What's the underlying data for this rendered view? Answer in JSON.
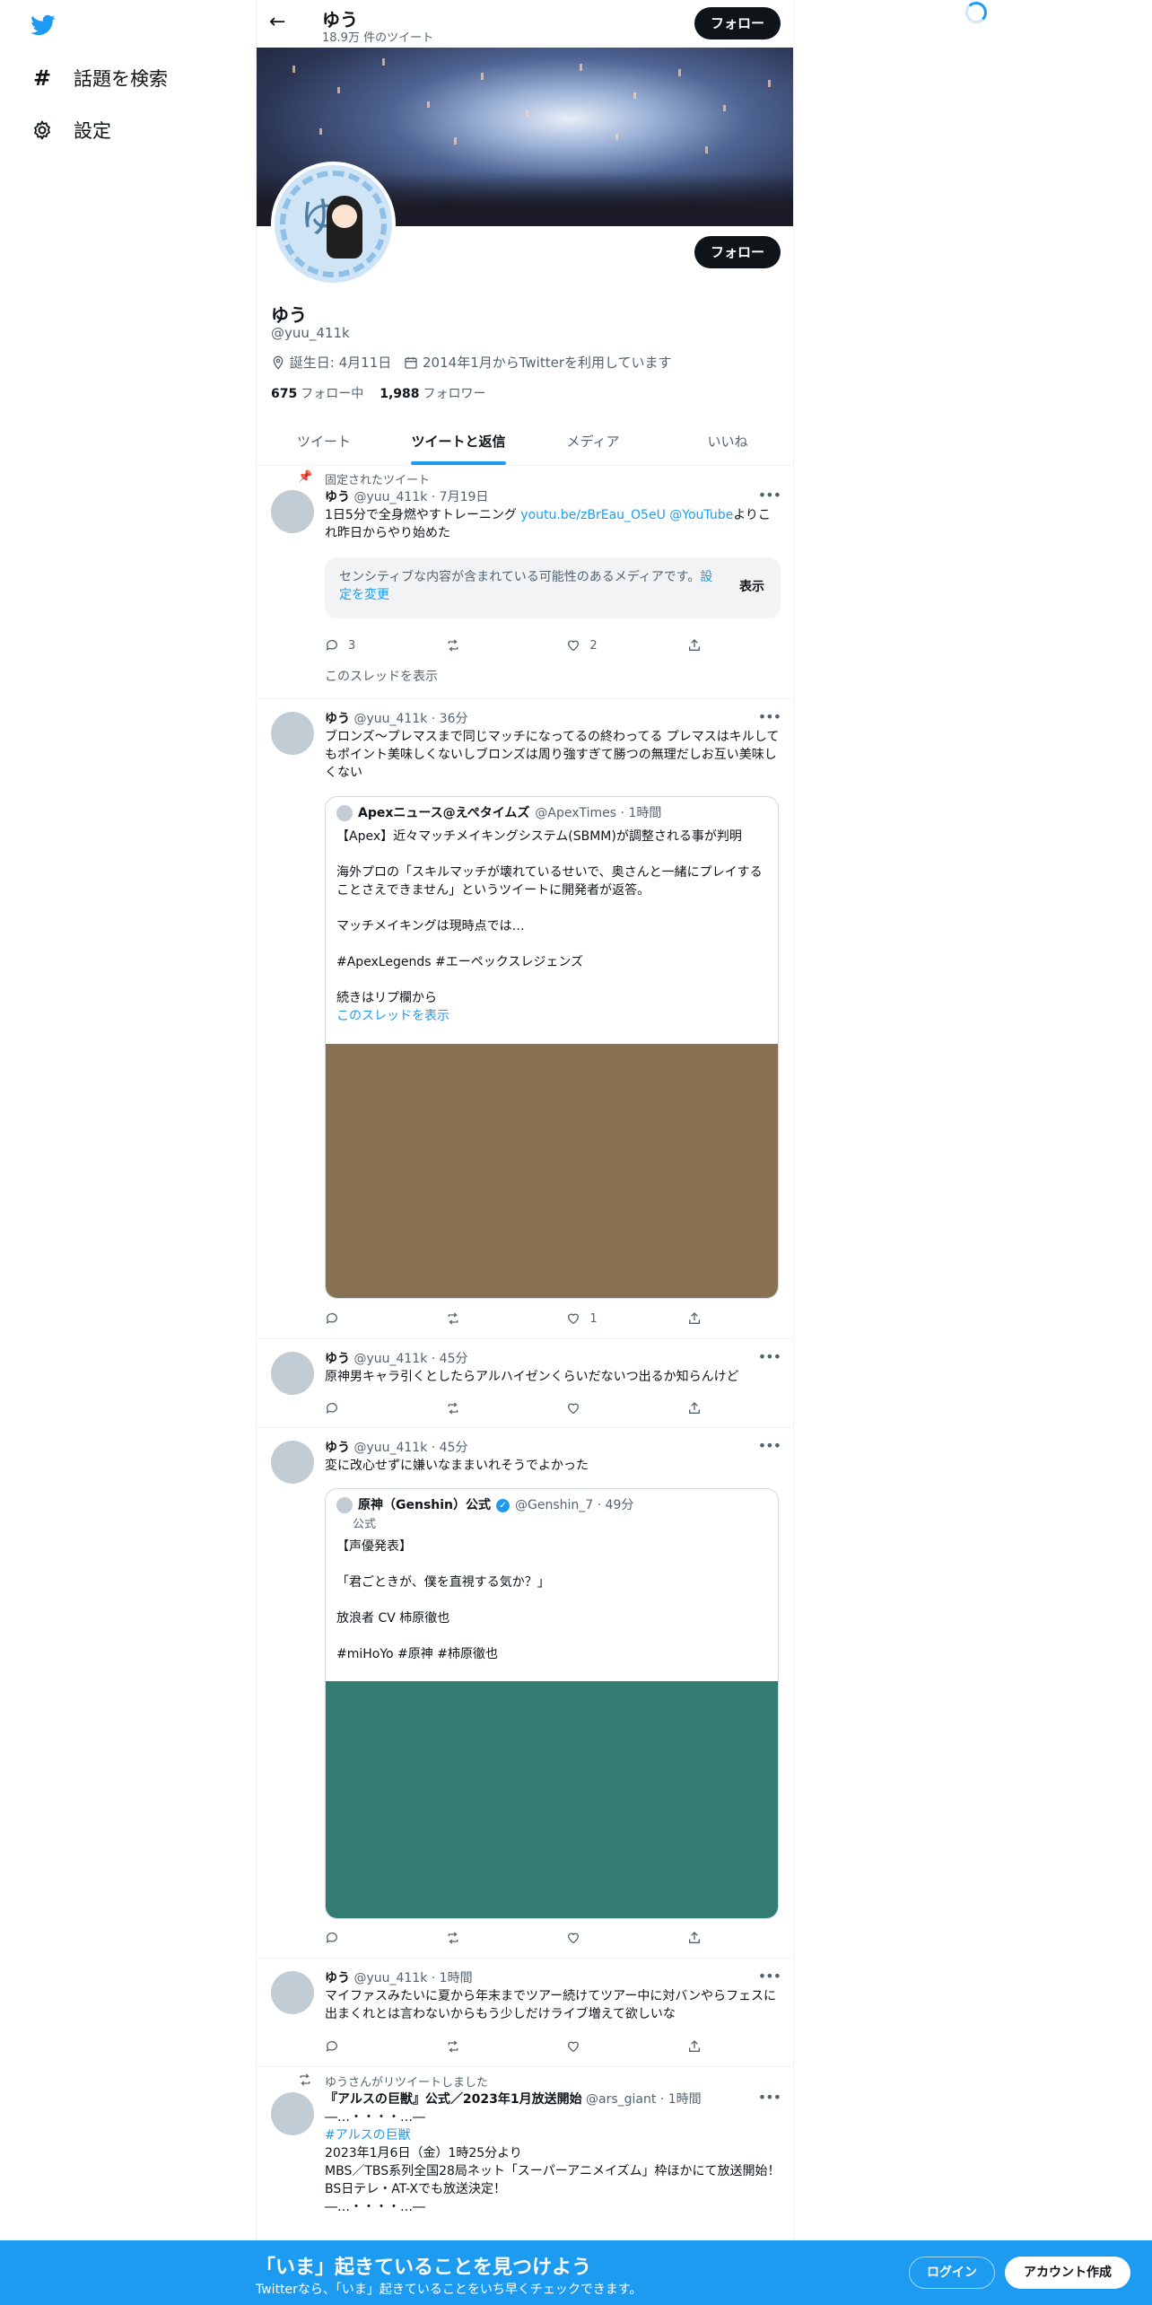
{
  "sidebar": {
    "items": [
      {
        "label": "話題を検索",
        "icon": "hashtag-icon"
      },
      {
        "label": "設定",
        "icon": "gear-icon"
      }
    ]
  },
  "header": {
    "name": "ゆう",
    "tweet_count": "18.9万 件のツイート",
    "follow_label": "フォロー"
  },
  "profile": {
    "name": "ゆう",
    "handle": "@yuu_411k",
    "birthday": "誕生日: 4月11日",
    "joined": "2014年1月からTwitterを利用しています",
    "following_count": "675",
    "following_label": "フォロー中",
    "followers_count": "1,988",
    "followers_label": "フォロワー",
    "follow_label": "フォロー"
  },
  "tabs": [
    {
      "label": "ツイート",
      "active": false
    },
    {
      "label": "ツイートと返信",
      "active": true
    },
    {
      "label": "メディア",
      "active": false
    },
    {
      "label": "いいね",
      "active": false
    }
  ],
  "tweets": [
    {
      "social": "固定されたツイート",
      "name": "ゆう",
      "meta": "@yuu_411k · 7月19日",
      "text_before": "1日5分で全身燃やすトレーニング ",
      "link1": "youtu.be/zBrEau_O5eU",
      "link2": "@YouTube",
      "text_after": "よりこれ昨日からやり始めた",
      "sensitive_msg": "センシティブな内容が含まれている可能性のあるメディアです。",
      "sensitive_link": "設定を変更",
      "show_label": "表示",
      "reply_count": "3",
      "like_count": "2",
      "thread_link": "このスレッドを表示"
    },
    {
      "name": "ゆう",
      "meta": "@yuu_411k · 36分",
      "text": "ブロンズ〜プレマスまで同じマッチになってるの終わってる プレマスはキルしてもポイント美味しくないしブロンズは周り強すぎて勝つの無理だしお互い美味しくない",
      "quote": {
        "name": "Apexニュース@えぺタイムズ",
        "meta": "@ApexTimes · 1時間",
        "paragraphs": [
          "【Apex】近々マッチメイキングシステム(SBMM)が調整される事が判明",
          "海外プロの「スキルマッチが壊れているせいで、奥さんと一緒にプレイすることさえできません」というツイートに開発者が返答。",
          "マッチメイキングは現時点では…",
          "#ApexLegends #エーペックスレジェンズ",
          "続きはリプ欄から"
        ],
        "thread_link": "このスレッドを表示",
        "media_color": "#877152"
      },
      "like_count": "1"
    },
    {
      "name": "ゆう",
      "meta": "@yuu_411k · 45分",
      "text": "原神男キャラ引くとしたらアルハイゼンくらいだないつ出るか知らんけど"
    },
    {
      "name": "ゆう",
      "meta": "@yuu_411k · 45分",
      "text": "変に改心せずに嫌いなままいれそうでよかった",
      "quote": {
        "name": "原神（Genshin）公式",
        "meta": "@Genshin_7 · 49分",
        "badge": "公式",
        "paragraphs": [
          "【声優発表】",
          "「君ごときが、僕を直視する気か？」",
          "放浪者 CV 柿原徹也",
          "#miHoYo #原神 #柿原徹也"
        ],
        "media_color": "#327c74"
      }
    },
    {
      "name": "ゆう",
      "meta": "@yuu_411k · 1時間",
      "text": "マイファスみたいに夏から年末までツアー続けてツアー中に対バンやらフェスに出まくれとは言わないからもう少しだけライブ増えて欲しいな"
    },
    {
      "social": "ゆうさんがリツイートしました",
      "name": "『アルスの巨獣』公式／2023年1月放送開始",
      "meta": "@ars_giant · 1時間",
      "line0": "―…・・・・…―",
      "hashtag": "#アルスの巨獣",
      "lines": [
        "2023年1月6日（金）1時25分より",
        "MBS／TBS系列全国28局ネット「スーパーアニメイズム」枠ほかにて放送開始！",
        "BS日テレ・AT-Xでも放送決定！",
        "―…・・・・…―"
      ]
    }
  ],
  "bottom_bar": {
    "title": "「いま」起きていることを見つけよう",
    "subtitle": "Twitterなら、「いま」起きていることをいち早くチェックできます。",
    "login_label": "ログイン",
    "signup_label": "アカウント作成"
  }
}
